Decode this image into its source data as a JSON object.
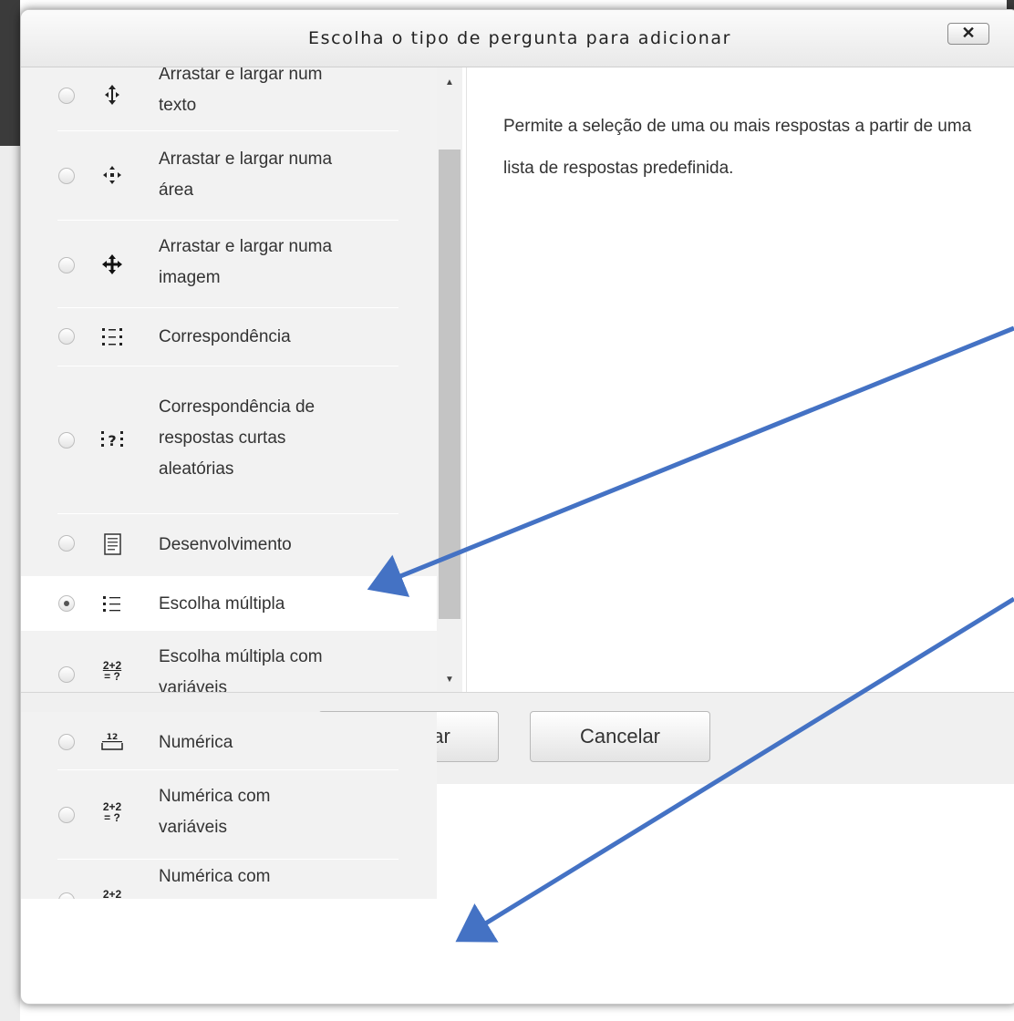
{
  "dialog": {
    "title": "Escolha o tipo de pergunta para adicionar",
    "close_label": "✕"
  },
  "options": [
    {
      "label": "Arrastar e largar num texto",
      "line1": "Arrastar e largar num",
      "line2": "texto",
      "icon": "drag-text-icon",
      "selected": false
    },
    {
      "label": "Arrastar e largar numa área",
      "line1": "Arrastar e largar numa",
      "line2": "área",
      "icon": "drag-area-icon",
      "selected": false
    },
    {
      "label": "Arrastar e largar numa imagem",
      "line1": "Arrastar e largar numa",
      "line2": "imagem",
      "icon": "drag-image-icon",
      "selected": false
    },
    {
      "label": "Correspondência",
      "icon": "matching-icon",
      "selected": false
    },
    {
      "label": "Correspondência de respostas curtas aleatórias",
      "line1": "Correspondência de",
      "line2": "respostas curtas",
      "line3": "aleatórias",
      "icon": "random-short-answer-matching-icon",
      "selected": false
    },
    {
      "label": "Desenvolvimento",
      "icon": "essay-icon",
      "selected": false
    },
    {
      "label": "Escolha múltipla",
      "icon": "multiple-choice-icon",
      "selected": true
    },
    {
      "label": "Escolha múltipla com variáveis",
      "line1": "Escolha múltipla com",
      "line2": "variáveis",
      "icon": "calculated-multichoice-icon",
      "icon_text_top": "2+2",
      "icon_text_bottom": "= ?",
      "selected": false
    },
    {
      "label": "Numérica",
      "icon": "numerical-icon",
      "icon_text": "12",
      "selected": false
    },
    {
      "label": "Numérica com variáveis",
      "line1": "Numérica com",
      "line2": "variáveis",
      "icon": "calculated-icon",
      "icon_text_top": "2+2",
      "icon_text_bottom": "= ?",
      "selected": false
    },
    {
      "label": "Numérica com",
      "line1": "Numérica com",
      "icon": "calculated-simple-icon",
      "icon_text_top": "2+2",
      "selected": false
    }
  ],
  "description": "Permite a seleção de uma ou mais respostas a partir de uma lista de respostas predefinida.",
  "buttons": {
    "add_label": "Adicionar",
    "cancel_label": "Cancelar"
  },
  "annotation": {
    "arrow_color": "#4472C4"
  }
}
